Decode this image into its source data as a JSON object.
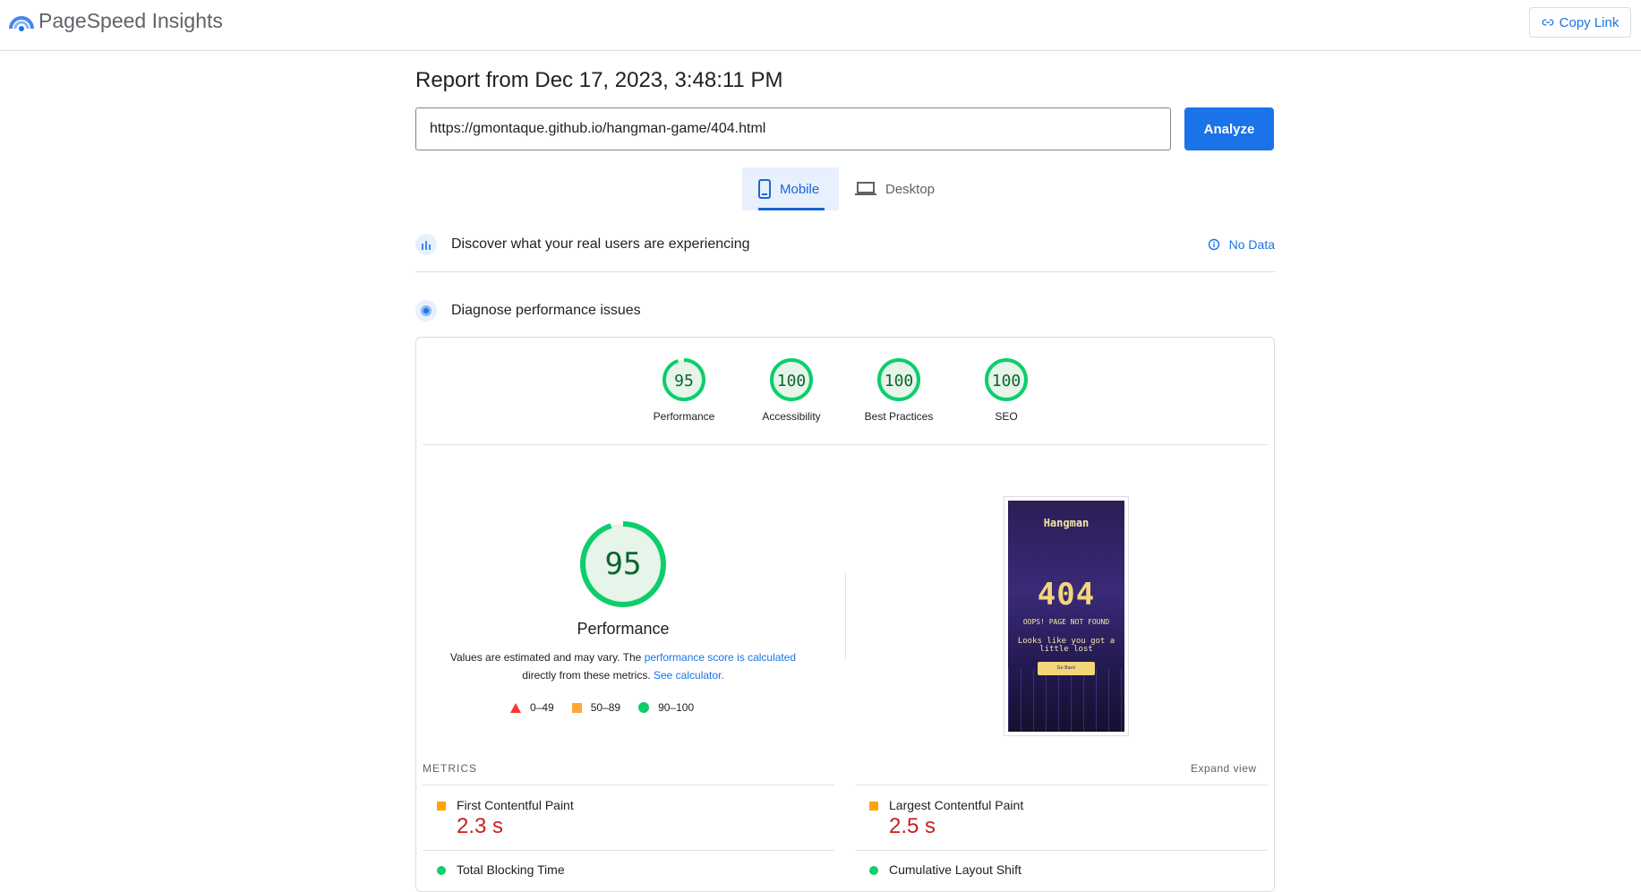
{
  "app": {
    "title": "PageSpeed Insights",
    "copy_link": "Copy Link"
  },
  "report": {
    "title": "Report from Dec 17, 2023, 3:48:11 PM",
    "url": "https://gmontaque.github.io/hangman-game/404.html",
    "analyze": "Analyze"
  },
  "tabs": [
    {
      "label": "Mobile",
      "active": true
    },
    {
      "label": "Desktop",
      "active": false
    }
  ],
  "field_data": {
    "label": "Discover what your real users are experiencing",
    "status": "No Data"
  },
  "diagnose": {
    "label": "Diagnose performance issues"
  },
  "categories": [
    {
      "score": "95",
      "label": "Performance"
    },
    {
      "score": "100",
      "label": "Accessibility"
    },
    {
      "score": "100",
      "label": "Best Practices"
    },
    {
      "score": "100",
      "label": "SEO"
    }
  ],
  "performance": {
    "score": "95",
    "label": "Performance",
    "note_pre": "Values are estimated and may vary. The",
    "note_link": "performance score is calculated",
    "note_mid": "directly from these metrics.",
    "note_link2": "See calculator."
  },
  "legend": [
    {
      "range": "0–49",
      "color": "#ff3333"
    },
    {
      "range": "50–89",
      "color": "#ffaa33"
    },
    {
      "range": "90–100",
      "color": "#0cce6b"
    }
  ],
  "screenshot": {
    "title": "Hangman",
    "code": "404",
    "subtitle": "OOPS! PAGE NOT FOUND",
    "message": "Looks like you got a little lost",
    "button": "Go Back"
  },
  "metrics": {
    "header": "METRICS",
    "expand": "Expand view",
    "items": [
      {
        "name": "First Contentful Paint",
        "value": "2.3 s",
        "status": "average"
      },
      {
        "name": "Largest Contentful Paint",
        "value": "2.5 s",
        "status": "average"
      },
      {
        "name": "Total Blocking Time",
        "value": "",
        "status": "good"
      },
      {
        "name": "Cumulative Layout Shift",
        "value": "",
        "status": "good"
      }
    ]
  },
  "colors": {
    "accent": "#1a73e8",
    "pass": "#0cce6b",
    "average": "#ffa400",
    "fail_value": "#c5221f"
  }
}
